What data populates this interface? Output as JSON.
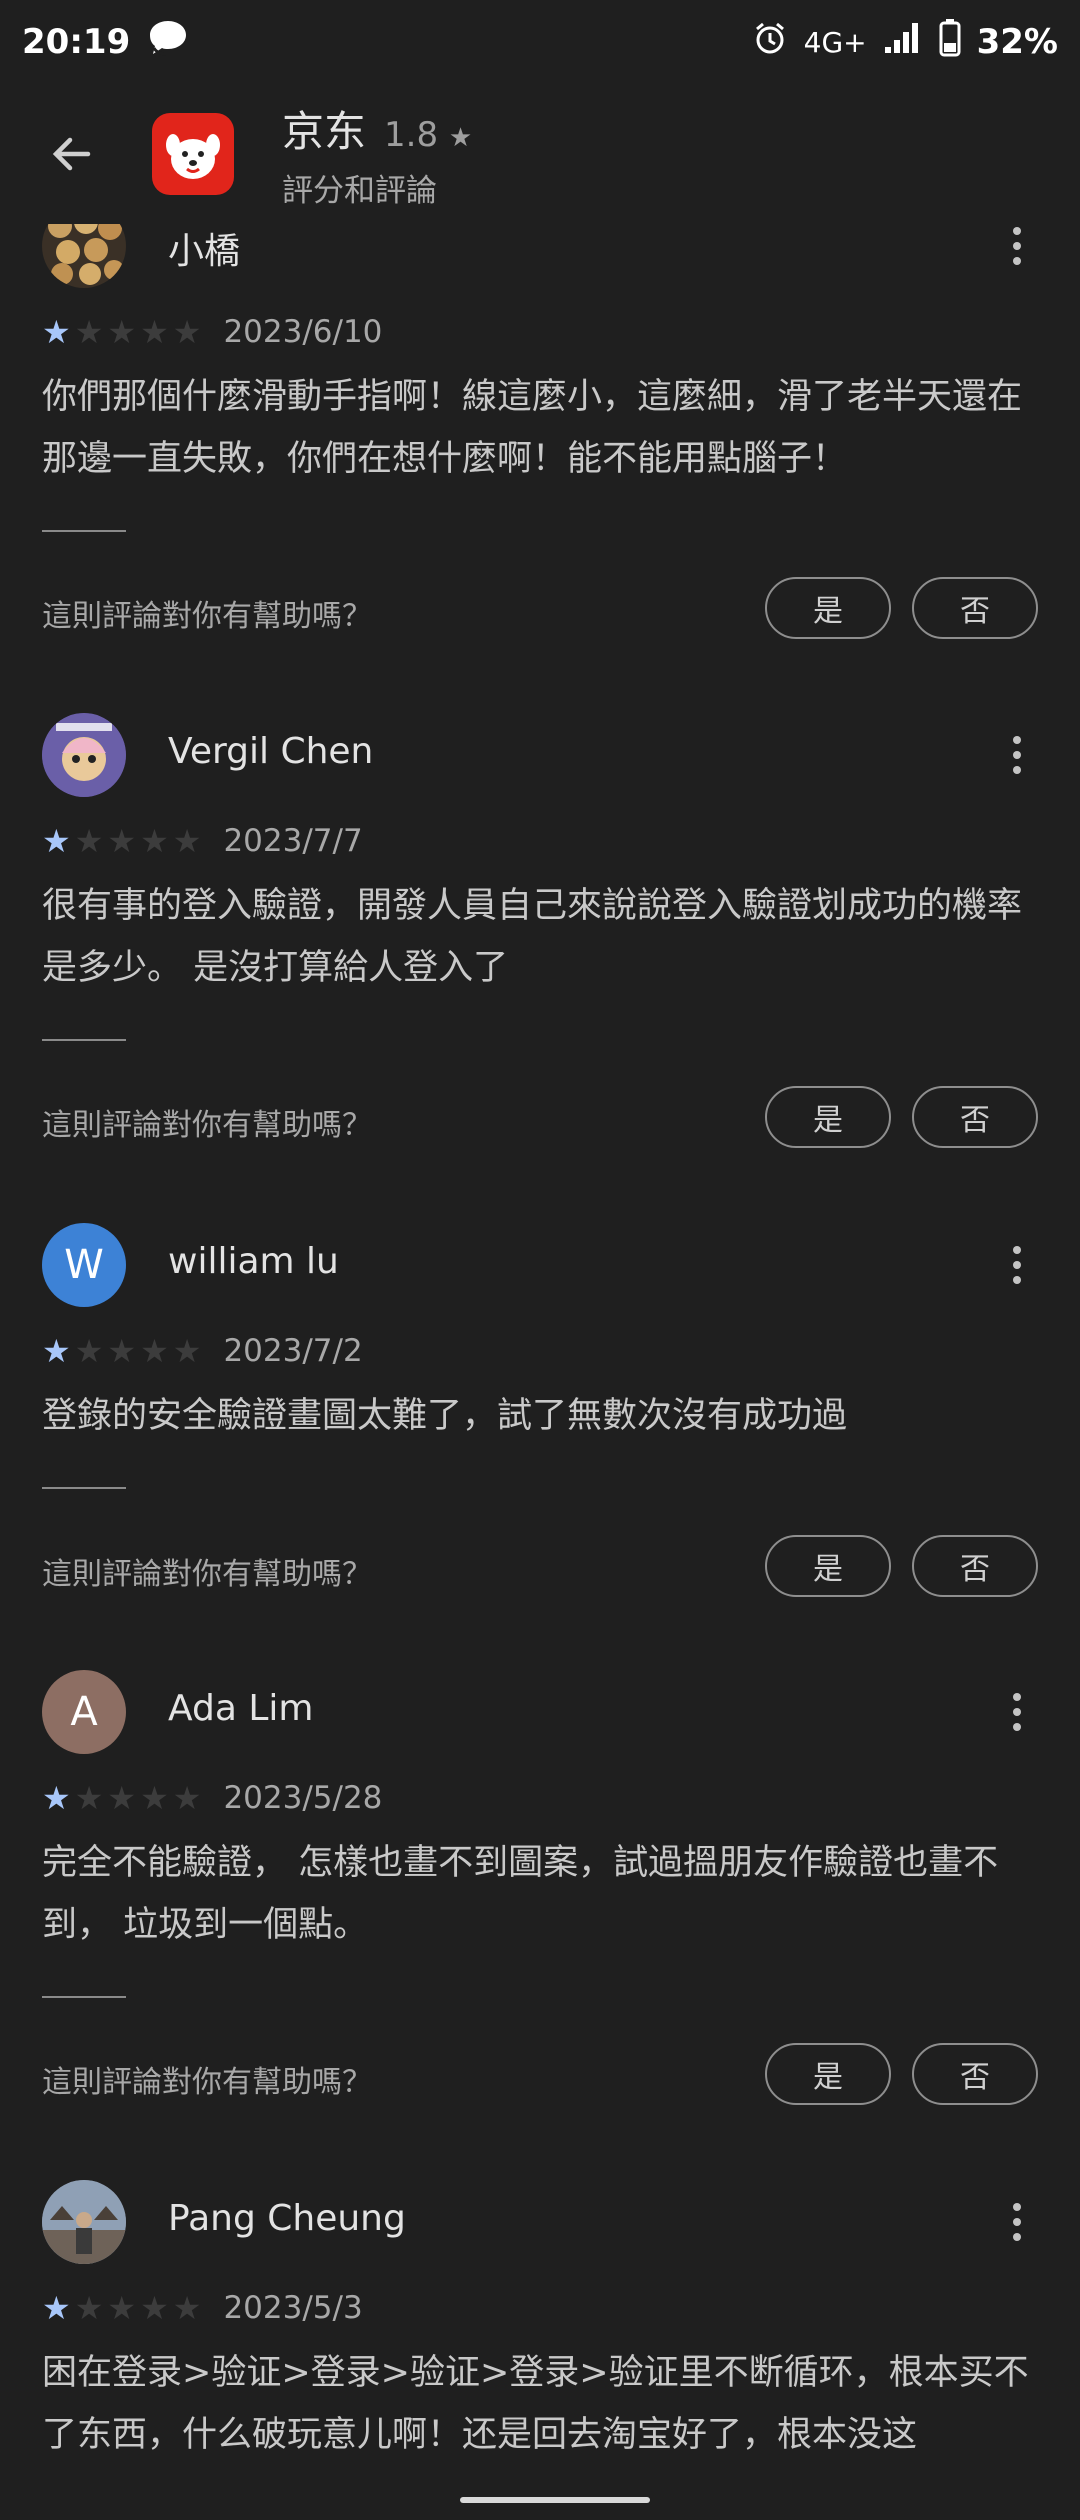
{
  "status_bar": {
    "time": "20:19",
    "network": "4G+",
    "battery": "32%",
    "icons": [
      "chat-bubble-icon",
      "alarm-icon",
      "signal-icon",
      "battery-icon"
    ]
  },
  "header": {
    "app_name": "京东",
    "rating": "1.8",
    "rating_star": "★",
    "subtitle": "評分和評論"
  },
  "helpful_question": "這則評論對你有幫助嗎？",
  "yes_label": "是",
  "no_label": "否",
  "reviews": [
    {
      "author": "小橋",
      "avatar_letter": "",
      "avatar_color": "#b58a4a",
      "stars": 1,
      "date": "2023/6/10",
      "text": "你們那個什麼滑動手指啊！線這麼小，這麼細，滑了老半天還在那邊一直失敗，你們在想什麼啊！能不能用點腦子！"
    },
    {
      "author": "Vergil Chen",
      "avatar_letter": "",
      "avatar_color": "#5a4f8c",
      "stars": 1,
      "date": "2023/7/7",
      "text": "很有事的登入驗證，開發人員自己來說說登入驗證划成功的機率是多少。 是沒打算給人登入了"
    },
    {
      "author": "william lu",
      "avatar_letter": "W",
      "avatar_color": "#3d82d6",
      "stars": 1,
      "date": "2023/7/2",
      "text": "登錄的安全驗證畫圖太難了，試了無數次沒有成功過"
    },
    {
      "author": "Ada Lim",
      "avatar_letter": "A",
      "avatar_color": "#8d6e63",
      "stars": 1,
      "date": "2023/5/28",
      "text": "完全不能驗證， 怎樣也畫不到圖案，試過搵朋友作驗證也畫不到， 垃圾到一個點。"
    },
    {
      "author": "Pang Cheung",
      "avatar_letter": "",
      "avatar_color": "#6b6f78",
      "stars": 1,
      "date": "2023/5/3",
      "text": "困在登录>验证>登录>验证>登录>验证里不断循环，根本买不了东西，什么破玩意儿啊！还是回去淘宝好了，根本没这"
    }
  ]
}
